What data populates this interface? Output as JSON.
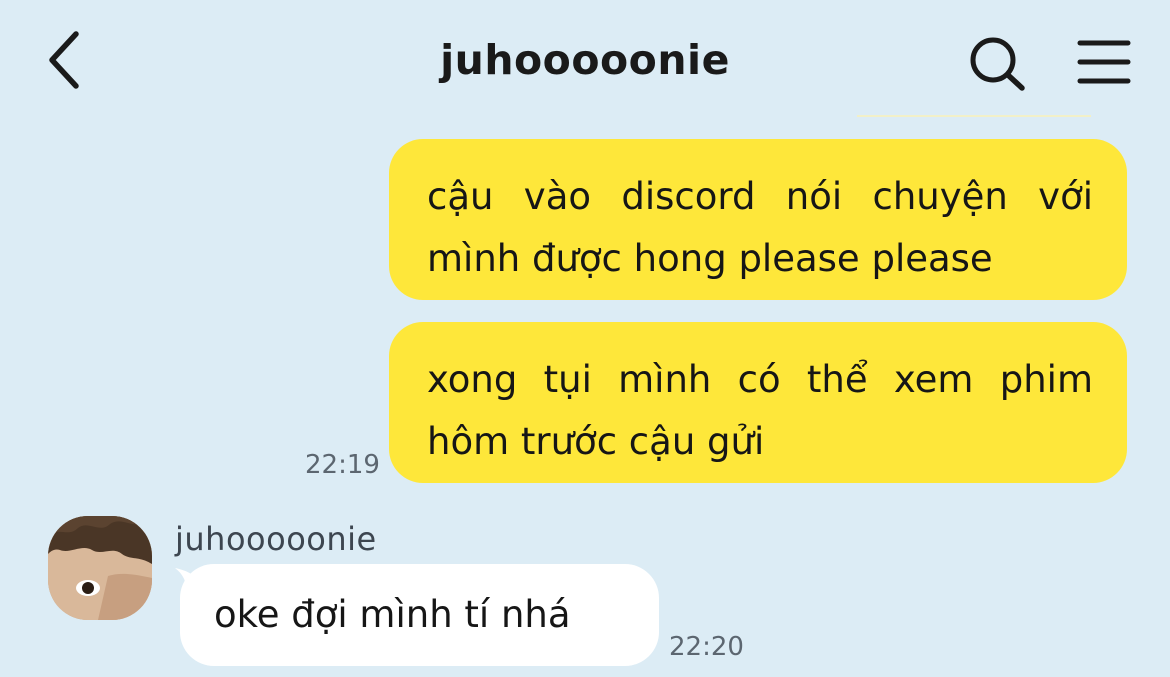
{
  "header": {
    "title": "juhooooonie",
    "back_icon": "chevron-left-icon",
    "search_icon": "search-icon",
    "menu_icon": "hamburger-menu-icon"
  },
  "messages": [
    {
      "direction": "outgoing",
      "lines": [
        "cậu vào discord nói chuyện với",
        "mình được hong please please"
      ]
    },
    {
      "direction": "outgoing",
      "lines": [
        "xong tụi mình có thể xem phim",
        "hôm trước cậu gửi"
      ],
      "time": "22:19"
    },
    {
      "direction": "incoming",
      "sender": "juhooooonie",
      "text": "oke đợi mình tí nhá",
      "time": "22:20"
    }
  ],
  "colors": {
    "background": "#dcecf5",
    "outgoing_bubble": "#fee73a",
    "incoming_bubble": "#ffffff"
  }
}
